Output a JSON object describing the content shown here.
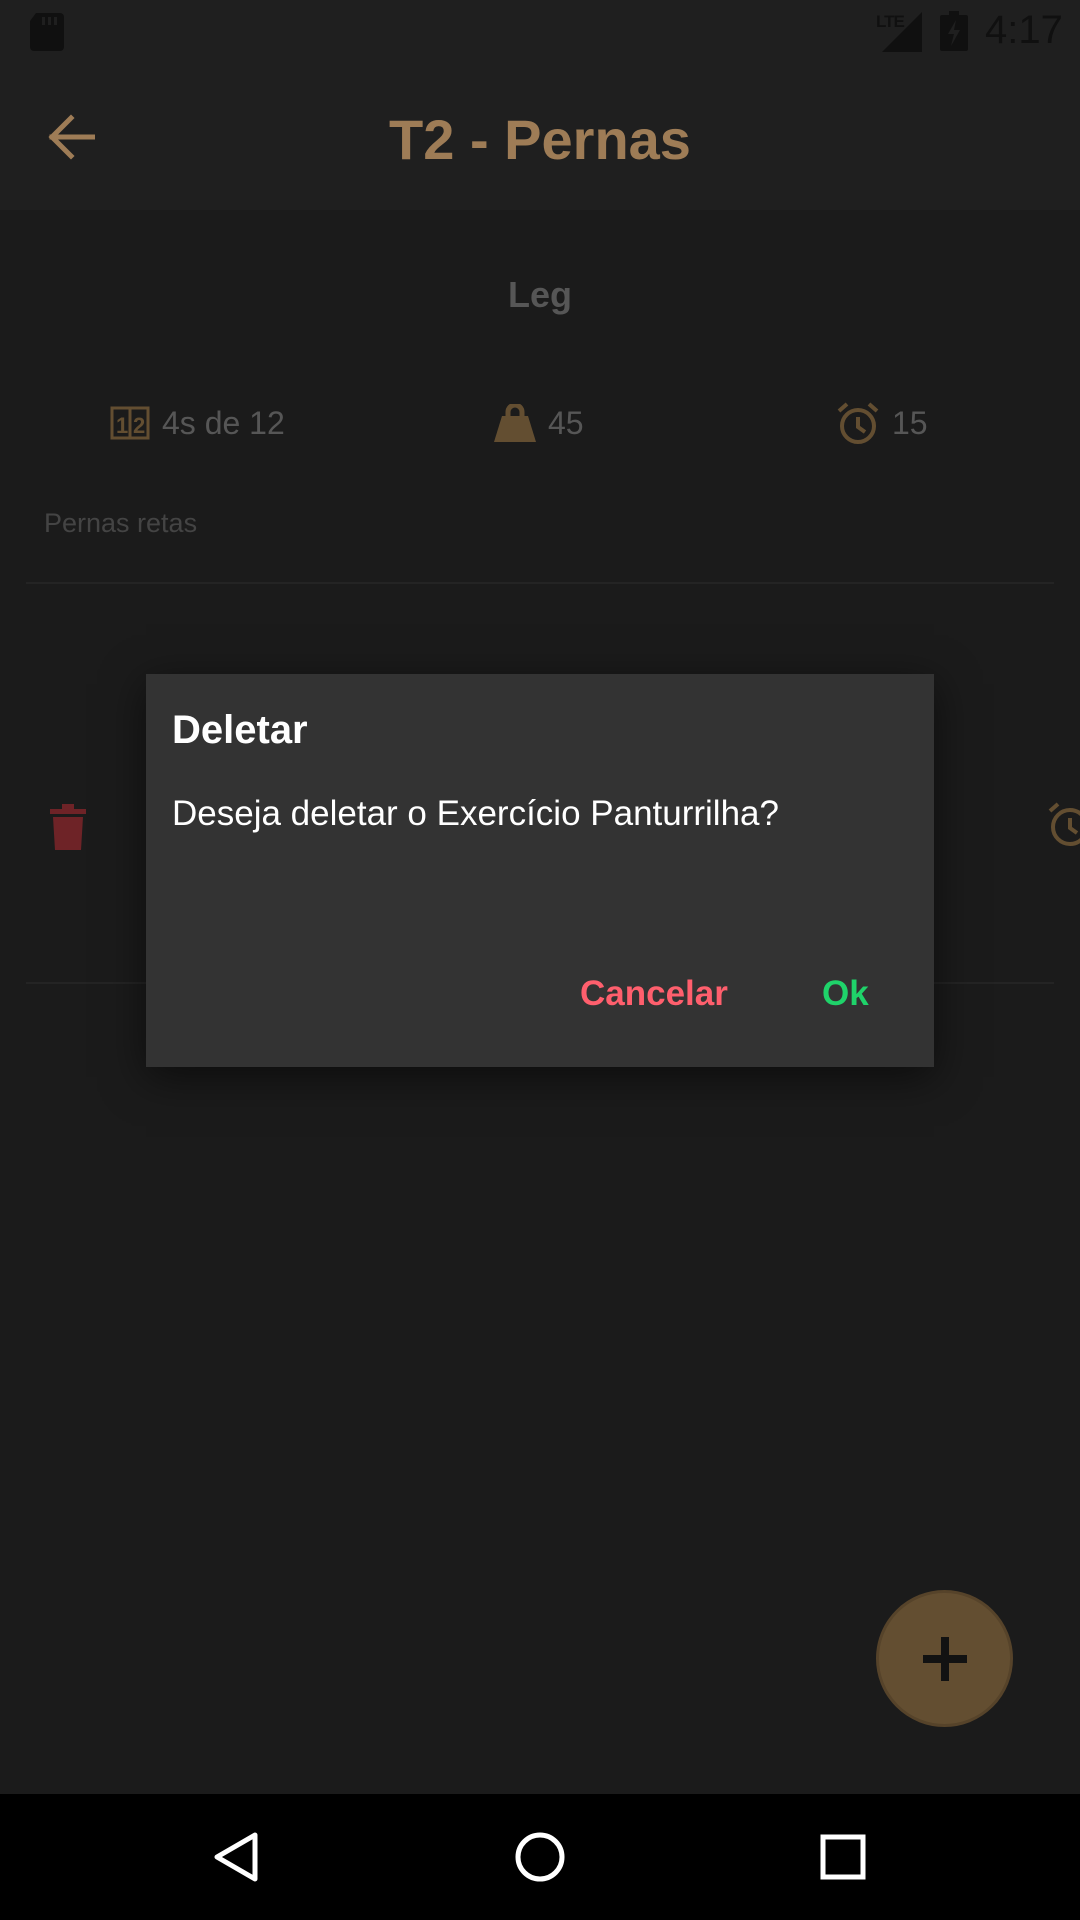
{
  "status_bar": {
    "network": "LTE",
    "time": "4:17",
    "icons": [
      "sd-card-icon",
      "signal-icon",
      "battery-charging-icon"
    ]
  },
  "app_bar": {
    "title": "T2 - Pernas",
    "back_icon": "arrow-left-icon"
  },
  "exercise": {
    "name": "Leg",
    "sets_label": "4s de 12",
    "weight": "45",
    "rest": "15",
    "note": "Pernas retas",
    "icons": [
      "counter-icon",
      "weight-icon",
      "alarm-icon"
    ]
  },
  "dialog": {
    "title": "Deletar",
    "message": "Deseja deletar o Exercício Panturrilha?",
    "cancel_label": "Cancelar",
    "ok_label": "Ok"
  },
  "fab": {
    "icon": "plus-icon"
  },
  "nav_bar": {
    "icons": [
      "back-triangle-icon",
      "home-circle-icon",
      "recents-square-icon"
    ]
  },
  "colors": {
    "accent": "#ffc98b",
    "icon_gold": "#a07f50",
    "cancel": "#ff5f6d",
    "ok": "#1fd36a",
    "trash": "#b2393f"
  }
}
